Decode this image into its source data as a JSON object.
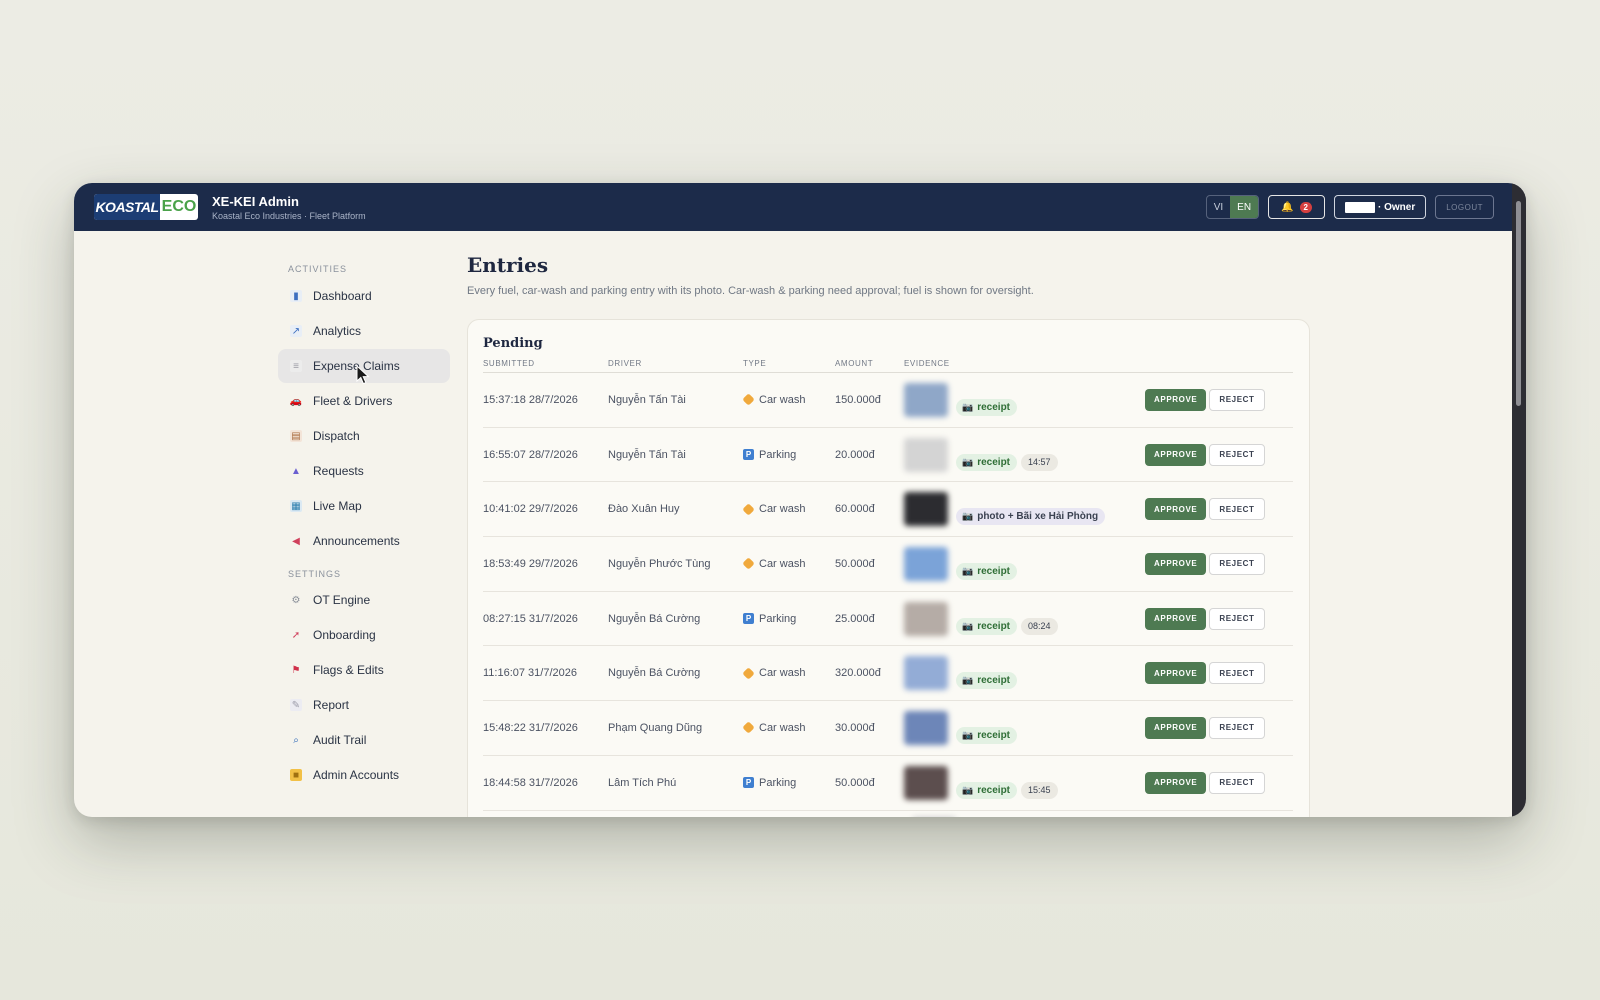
{
  "app": {
    "logo_text_left": "KOASTAL",
    "logo_text_right": "ECO",
    "title": "XE-KEI Admin",
    "subtitle": "Koastal Eco Industries · Fleet Platform"
  },
  "header": {
    "languages": [
      "VI",
      "EN"
    ],
    "active_language": "EN",
    "notification_count": "2",
    "owner_label": "· Owner",
    "logout_label": "LOGOUT"
  },
  "sidebar": {
    "activities_label": "ACTIVITIES",
    "settings_label": "SETTINGS",
    "activities": [
      {
        "label": "Dashboard",
        "icon": "bar-chart-icon"
      },
      {
        "label": "Analytics",
        "icon": "line-chart-icon"
      },
      {
        "label": "Expense Claims",
        "icon": "receipt-icon",
        "active": true
      },
      {
        "label": "Fleet & Drivers",
        "icon": "car-icon"
      },
      {
        "label": "Dispatch",
        "icon": "clipboard-icon"
      },
      {
        "label": "Requests",
        "icon": "inbox-icon"
      },
      {
        "label": "Live Map",
        "icon": "map-icon"
      },
      {
        "label": "Announcements",
        "icon": "megaphone-icon"
      }
    ],
    "settings": [
      {
        "label": "OT Engine",
        "icon": "gear-icon"
      },
      {
        "label": "Onboarding",
        "icon": "rocket-icon"
      },
      {
        "label": "Flags & Edits",
        "icon": "flag-icon"
      },
      {
        "label": "Report",
        "icon": "document-icon"
      },
      {
        "label": "Audit Trail",
        "icon": "magnifier-icon"
      },
      {
        "label": "Admin Accounts",
        "icon": "lock-icon"
      }
    ]
  },
  "main": {
    "title": "Entries",
    "description": "Every fuel, car-wash and parking entry with its photo. Car-wash & parking need approval; fuel is shown for oversight.",
    "pending": {
      "title": "Pending",
      "columns": [
        "SUBMITTED",
        "DRIVER",
        "TYPE",
        "AMOUNT",
        "EVIDENCE"
      ],
      "approve_label": "APPROVE",
      "reject_label": "REJECT",
      "rows": [
        {
          "submitted": "15:37:18 28/7/2026",
          "driver": "Nguyễn Tấn Tài",
          "type": "Car wash",
          "amount": "150.000đ",
          "evidence": "receipt",
          "time": ""
        },
        {
          "submitted": "16:55:07 28/7/2026",
          "driver": "Nguyễn Tấn Tài",
          "type": "Parking",
          "amount": "20.000đ",
          "evidence": "receipt",
          "time": "14:57"
        },
        {
          "submitted": "10:41:02 29/7/2026",
          "driver": "Đào Xuân Huy",
          "type": "Car wash",
          "amount": "60.000đ",
          "evidence": "photo + Bãi xe Hải Phòng",
          "time": ""
        },
        {
          "submitted": "18:53:49 29/7/2026",
          "driver": "Nguyễn Phước Tùng",
          "type": "Car wash",
          "amount": "50.000đ",
          "evidence": "receipt",
          "time": ""
        },
        {
          "submitted": "08:27:15 31/7/2026",
          "driver": "Nguyễn Bá Cường",
          "type": "Parking",
          "amount": "25.000đ",
          "evidence": "receipt",
          "time": "08:24"
        },
        {
          "submitted": "11:16:07 31/7/2026",
          "driver": "Nguyễn Bá Cường",
          "type": "Car wash",
          "amount": "320.000đ",
          "evidence": "receipt",
          "time": ""
        },
        {
          "submitted": "15:48:22 31/7/2026",
          "driver": "Phạm Quang Dũng",
          "type": "Car wash",
          "amount": "30.000đ",
          "evidence": "receipt",
          "time": ""
        },
        {
          "submitted": "18:44:58 31/7/2026",
          "driver": "Lâm Tích Phú",
          "type": "Parking",
          "amount": "50.000đ",
          "evidence": "receipt",
          "time": "15:45"
        }
      ]
    }
  },
  "colors": {
    "topbar": "#1c2b4a",
    "accent_green": "#4e7a52",
    "page_bg": "#f5f3ec"
  }
}
